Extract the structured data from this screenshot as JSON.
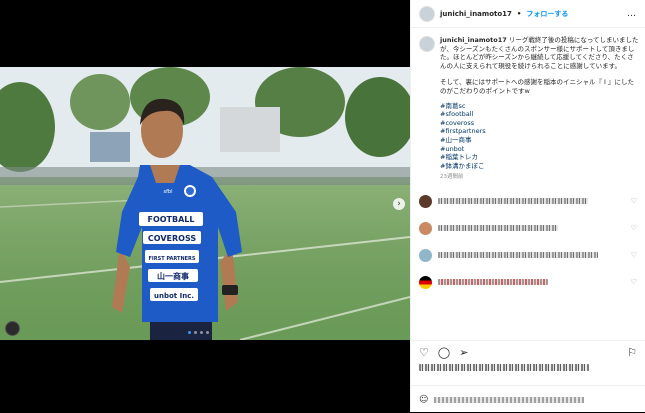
{
  "header": {
    "username": "junichi_inamoto17",
    "separator": "•",
    "follow_label": "フォローする",
    "more_icon": "…"
  },
  "caption": {
    "username": "junichi_inamoto17",
    "text": "リーグ戦終了後の投稿になってしまいましたが、今シーズンもたくさんのスポンサー様にサポートして頂きました。ほとんどが昨シーズンから継続して応援してくださり、たくさんの人に支えられて現役を続けられることに感謝しています。",
    "text2": "そして、裏にはサポートへの感謝を稲本のイニシャル『 I 』にしたのがこだわりのポイントですw",
    "hashtags": [
      "#南葛sc",
      "#sfootball",
      "#coveross",
      "#firstpartners",
      "#山一商事",
      "#unbot",
      "#稲葉トレカ",
      "#鉢溝かまぼこ"
    ],
    "time": "23週間前"
  },
  "shirt": {
    "sponsors": [
      "FOOTBALL",
      "COVEROSS",
      "FIRST PARTNERS",
      "山一商事",
      "unbot Inc."
    ],
    "brand": "sfbl"
  },
  "colors": {
    "follow": "#0095f6",
    "hashtag": "#00376b",
    "shirt": "#1e5bc6"
  },
  "icons": {
    "next": "›",
    "heart": "♡",
    "like": "♡",
    "comment": "◯",
    "share": "➢",
    "save": "⚐"
  }
}
